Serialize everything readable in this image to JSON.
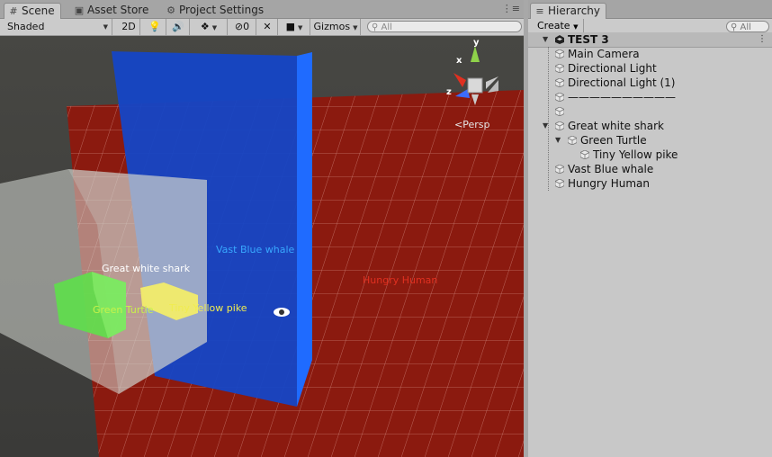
{
  "scene_tabs": {
    "scene": "Scene",
    "asset_store": "Asset Store",
    "project_settings": "Project Settings",
    "menu": "⋮≡"
  },
  "toolbar": {
    "shading_mode": "Shaded",
    "mode_2d": "2D",
    "hidden_count": "0",
    "gizmos": "Gizmos",
    "search_placeholder": "All"
  },
  "viewport": {
    "projection": "Persp",
    "axes": {
      "x": "x",
      "y": "y",
      "z": "z"
    },
    "labels": {
      "great_white_shark": "Great white shark",
      "vast_blue_whale": "Vast Blue whale",
      "hungry_human": "Hungry Human",
      "green_turtle": "Green Turtle",
      "tiny_yellow_pike": "Tiny Yellow pike"
    },
    "colors": {
      "ground": "#8b1a0f",
      "whale": "#1546c6",
      "shark": "#c8cac6",
      "turtle": "#5ee04a",
      "pike": "#f2ec6a",
      "human_label": "#e03020",
      "whale_label": "#38a8ff",
      "turtle_label": "#c8f24a",
      "pike_label": "#f0ec50"
    }
  },
  "hierarchy": {
    "tab": "Hierarchy",
    "create": "Create",
    "search_placeholder": "All",
    "scene_name": "TEST 3",
    "items": [
      {
        "name": "Main Camera",
        "depth": 1
      },
      {
        "name": "Directional Light",
        "depth": 1
      },
      {
        "name": "Directional Light (1)",
        "depth": 1
      },
      {
        "name": "——————————",
        "depth": 1
      },
      {
        "name": "",
        "depth": 1
      },
      {
        "name": "Great white shark",
        "depth": 1
      },
      {
        "name": "Green Turtle",
        "depth": 2
      },
      {
        "name": "Tiny Yellow pike",
        "depth": 3
      },
      {
        "name": "Vast Blue whale",
        "depth": 1
      },
      {
        "name": "Hungry Human",
        "depth": 1
      }
    ]
  }
}
